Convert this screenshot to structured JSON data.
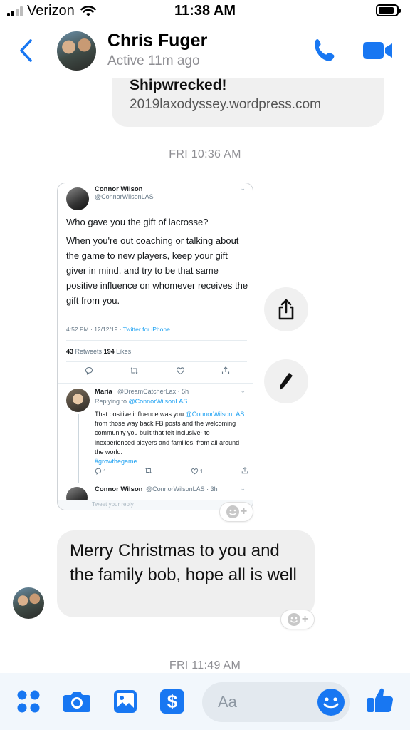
{
  "status_bar": {
    "carrier": "Verizon",
    "time": "11:38 AM"
  },
  "header": {
    "contact_name": "Chris Fuger",
    "status": "Active 11m ago"
  },
  "link_preview": {
    "title": "Shipwrecked!",
    "url": "2019laxodyssey.wordpress.com"
  },
  "timestamps": {
    "first": "FRI 10:36 AM",
    "second": "FRI 11:49 AM"
  },
  "tweet": {
    "author_name": "Connor Wilson",
    "author_handle": "@ConnorWilsonLAS",
    "paragraph_1": "Who gave you the gift of lacrosse?",
    "paragraph_2": "When you're out coaching or talking about the game to new players, keep your gift giver in mind, and try to be that same positive influence on whomever receives the gift from you.",
    "time_date": "4:52 PM · 12/12/19 · ",
    "source": "Twitter for iPhone",
    "retweets": "43",
    "retweets_label": "Retweets",
    "likes": "194",
    "likes_label": "Likes",
    "reply": {
      "name": "Maria",
      "handle": "@DreamCatcherLax · 5h",
      "replying_prefix": "Replying to ",
      "replying_to": "@ConnorWilsonLAS",
      "text_1": "That positive influence was you",
      "mention": "@ConnorWilsonLAS",
      "text_2": " from those way back FB posts and the welcoming community you built that felt inclusive- to inexperienced players and families, from all around the world.",
      "hashtag": "#growthegame",
      "reply_count": "1",
      "like_count": "1"
    },
    "next_reply": {
      "name": "Connor Wilson",
      "handle": "@ConnorWilsonLAS · 3h"
    },
    "reply_placeholder": "Tweet your reply"
  },
  "message": {
    "text": "Merry Christmas to you and the family bob, hope all is well"
  },
  "composer": {
    "placeholder": "Aa"
  },
  "colors": {
    "accent": "#1877f2",
    "bubble_gray": "#efefef",
    "twitter_blue": "#1da1f2"
  },
  "icons": {
    "back": "chevron-left-icon",
    "call": "phone-icon",
    "video": "video-camera-icon",
    "share": "share-icon",
    "edit": "pen-icon",
    "apps": "four-dots-icon",
    "camera": "camera-icon",
    "gallery": "image-icon",
    "pay": "dollar-sign-icon",
    "emoji": "smiley-icon",
    "like": "thumbs-up-icon"
  }
}
